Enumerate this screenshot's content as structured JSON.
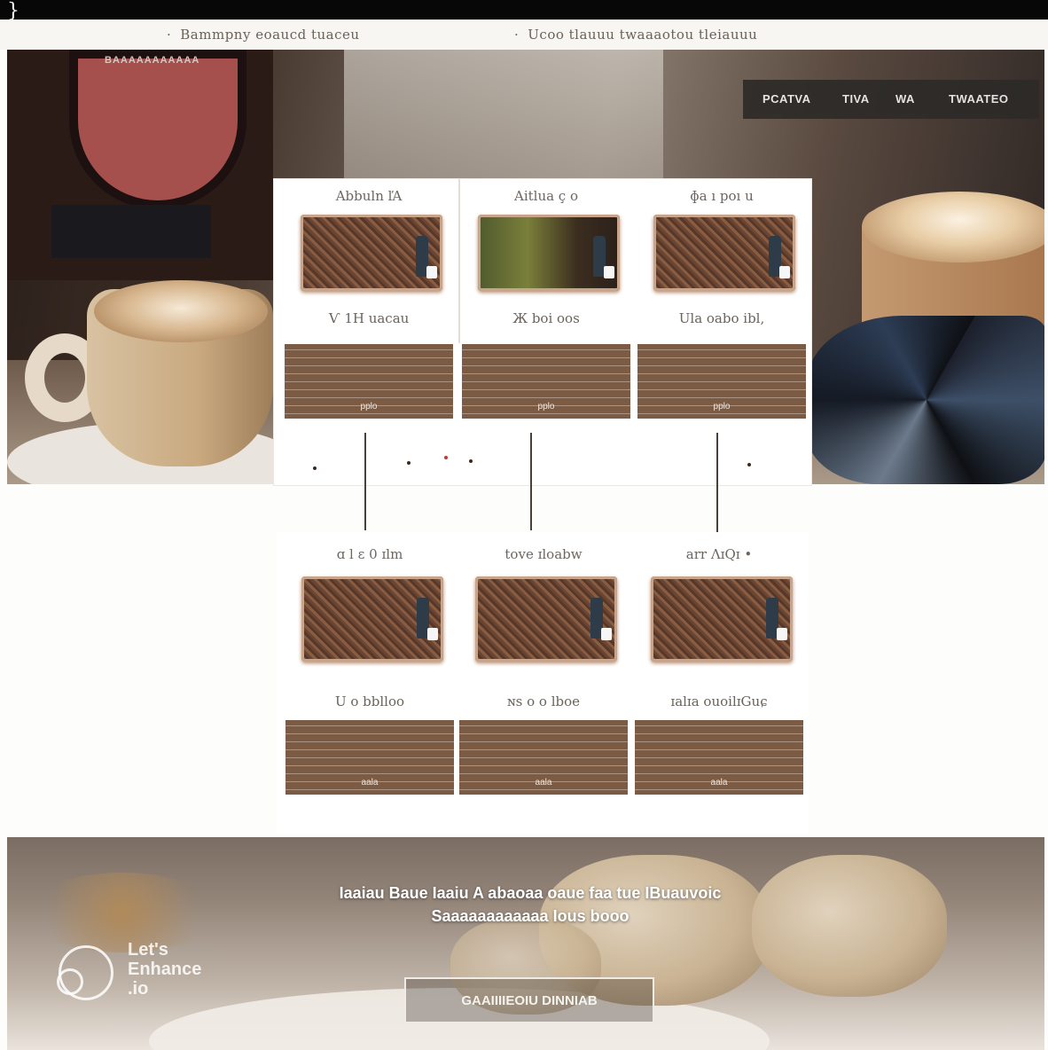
{
  "topbar": {
    "glyph": "}"
  },
  "subnav": {
    "items": [
      {
        "label": "Bammpny eoaucd tuaceu"
      },
      {
        "label": "Ucoo tlauuu twaaaotou tleiauuu"
      }
    ]
  },
  "hero": {
    "brand_strip": "BAAAAAAAAAAA",
    "nav": [
      {
        "label": "PCATVA"
      },
      {
        "label": "TIVA"
      },
      {
        "label": "WA"
      },
      {
        "label": "TWAATEO"
      }
    ]
  },
  "products_top": [
    {
      "name": "Abbuln ľA",
      "price": "Ѵ 1H uacau",
      "button": "pplo"
    },
    {
      "name": "Aitlua ç o",
      "price": "Ж boi oos",
      "button": "pplo"
    },
    {
      "name": "ɸa ı poı u",
      "price": "Ula oabo ibl,",
      "button": "pplo"
    }
  ],
  "products_bottom": [
    {
      "name": "ɑ l ɛ 0 ɪlm",
      "price": "U o bblloo",
      "button": "aala"
    },
    {
      "name": "tove ɪloabw",
      "price": "ɴs o o lboe",
      "button": "aala"
    },
    {
      "name": "arr ɅɪQɪ •",
      "price": "ɪalɪa ouoilɪGuɕ",
      "button": "aala"
    }
  ],
  "footer": {
    "headline": "Iaaiau Baue Iaaiu A abaoaa oaue faa tue IBuauvoic Saaaaaaaaaaaa Ious booo",
    "cta": "GAAIIIIEOIU DINNIAB",
    "watermark": "Let's\nEnhance\n.io"
  }
}
